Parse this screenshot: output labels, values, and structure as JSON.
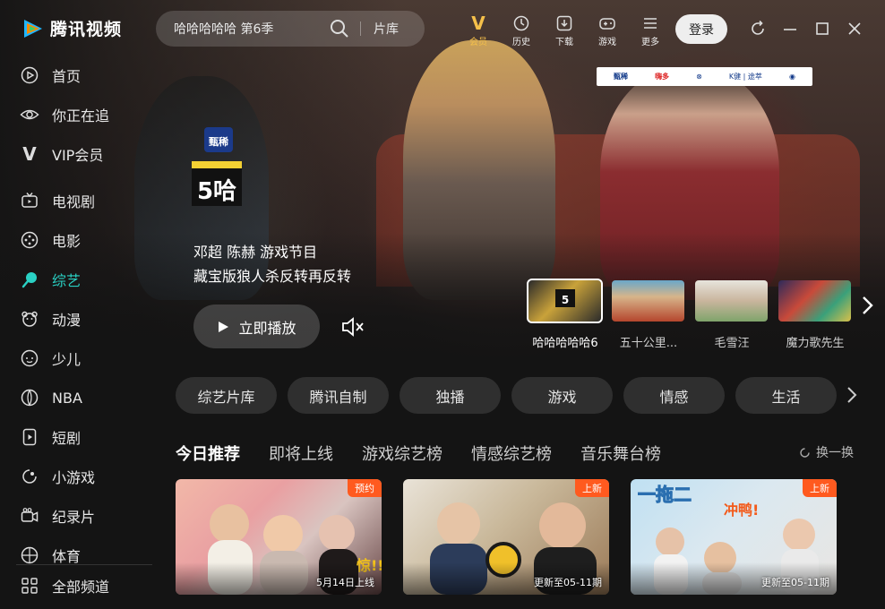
{
  "app": {
    "name": "腾讯视频"
  },
  "search": {
    "query": "哈哈哈哈哈 第6季",
    "library_label": "片库"
  },
  "toolbar": [
    {
      "label": "会员",
      "icon": "vip-icon"
    },
    {
      "label": "历史",
      "icon": "history-icon"
    },
    {
      "label": "下载",
      "icon": "download-icon"
    },
    {
      "label": "游戏",
      "icon": "gamepad-icon"
    },
    {
      "label": "更多",
      "icon": "menu-icon"
    }
  ],
  "login_label": "登录",
  "sidebar": {
    "items": [
      {
        "label": "首页",
        "icon": "play-circle-icon"
      },
      {
        "label": "你正在追",
        "icon": "eye-icon"
      },
      {
        "label": "VIP会员",
        "icon": "vip-icon"
      },
      {
        "label": "电视剧",
        "icon": "tv-icon"
      },
      {
        "label": "电影",
        "icon": "film-reel-icon"
      },
      {
        "label": "综艺",
        "icon": "microphone-icon",
        "active": true
      },
      {
        "label": "动漫",
        "icon": "bear-icon"
      },
      {
        "label": "少儿",
        "icon": "kid-icon"
      },
      {
        "label": "NBA",
        "icon": "basketball-icon"
      },
      {
        "label": "短剧",
        "icon": "short-drama-icon"
      },
      {
        "label": "小游戏",
        "icon": "mini-game-icon"
      },
      {
        "label": "纪录片",
        "icon": "camera-icon"
      },
      {
        "label": "体育",
        "icon": "sports-ball-icon"
      }
    ],
    "all_channels_label": "全部频道"
  },
  "hero": {
    "cast": "邓超 陈赫 游戏节目",
    "description": "藏宝版狼人杀反转再反转",
    "play_label": "立即播放",
    "show_logo_text": "5哈",
    "thumbnails": [
      {
        "label": "哈哈哈哈哈6",
        "active": true
      },
      {
        "label": "五十公里..."
      },
      {
        "label": "毛雪汪"
      },
      {
        "label": "魔力歌先生"
      }
    ]
  },
  "accent_color": "#2ad1c4",
  "badge_color": "#ff5a1f",
  "chips": [
    "综艺片库",
    "腾讯自制",
    "独播",
    "游戏",
    "情感",
    "生活"
  ],
  "tabs": [
    "今日推荐",
    "即将上线",
    "游戏综艺榜",
    "情感综艺榜",
    "音乐舞台榜"
  ],
  "refresh_label": "换一换",
  "cards": [
    {
      "badge": "预约",
      "caption": "5月14日上线"
    },
    {
      "badge": "上新",
      "caption": "更新至05-11期"
    },
    {
      "badge": "上新",
      "caption": "更新至05-11期"
    }
  ]
}
